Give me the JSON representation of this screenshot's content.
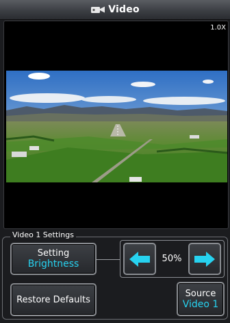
{
  "title": {
    "label": "Video",
    "icon": "video-camera-icon"
  },
  "video": {
    "zoom": "1.0X"
  },
  "settings": {
    "group_label": "Video 1 Settings",
    "setting_button": {
      "line1": "Setting",
      "line2": "Brightness"
    },
    "adjust": {
      "value": "50%",
      "left_icon": "arrow-left-icon",
      "right_icon": "arrow-right-icon"
    },
    "restore_button": {
      "label": "Restore Defaults"
    },
    "source_button": {
      "line1": "Source",
      "line2": "Video 1"
    }
  },
  "colors": {
    "accent_cyan": "#27d2f0",
    "background": "#1b1c1f",
    "button_border": "#8a8d92"
  }
}
